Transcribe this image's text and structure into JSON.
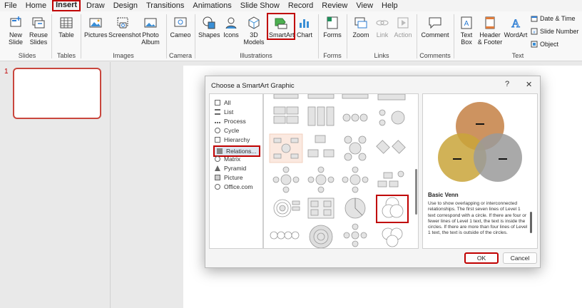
{
  "menu": [
    "File",
    "Home",
    "Insert",
    "Draw",
    "Design",
    "Transitions",
    "Animations",
    "Slide Show",
    "Record",
    "Review",
    "View",
    "Help"
  ],
  "ribbon": {
    "new_slide": "New Slide",
    "reuse_slides": "Reuse Slides",
    "table": "Table",
    "pictures": "Pictures",
    "screenshot": "Screenshot",
    "photo_album": "Photo Album",
    "cameo": "Cameo",
    "shapes": "Shapes",
    "icons": "Icons",
    "models_3d": "3D Models",
    "smartart": "SmartArt",
    "chart": "Chart",
    "forms": "Forms",
    "zoom": "Zoom",
    "link": "Link",
    "action": "Action",
    "comment": "Comment",
    "text_box": "Text Box",
    "header_footer": "Header & Footer",
    "wordart": "WordArt",
    "date_time": "Date & Time",
    "slide_number": "Slide Number",
    "object": "Object",
    "groups": {
      "slides": "Slides",
      "tables": "Tables",
      "images": "Images",
      "camera": "Camera",
      "illustrations": "Illustrations",
      "forms": "Forms",
      "links": "Links",
      "comments": "Comments",
      "text": "Text"
    }
  },
  "slide_panel": {
    "slide_number": "1"
  },
  "dialog": {
    "title": "Choose a SmartArt Graphic",
    "help": "?",
    "close": "✕",
    "categories": [
      "All",
      "List",
      "Process",
      "Cycle",
      "Hierarchy",
      "Relations...",
      "Matrix",
      "Pyramid",
      "Picture",
      "Office.com"
    ],
    "selected_category": "Relations...",
    "preview_title": "Basic Venn",
    "preview_desc": "Use to show overlapping or interconnected relationships. The first seven lines of Level 1 text correspond with a circle. If there are four or fewer lines of Level 1 text, the text is inside the circles. If there are more than four lines of Level 1 text, the text is outside of the circles.",
    "ok": "OK",
    "cancel": "Cancel"
  },
  "colors": {
    "accent_red": "#c00000",
    "venn_top": "#c98a52",
    "venn_left": "#c9a53a",
    "venn_right": "#9a9a9a"
  }
}
